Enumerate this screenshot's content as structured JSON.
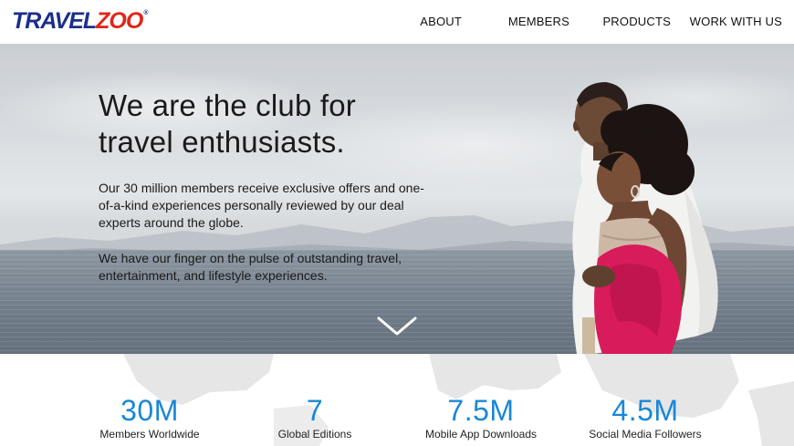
{
  "header": {
    "logo": {
      "text_main": "TRAVEL",
      "text_accent": "ZOO",
      "registered": "®"
    },
    "nav": [
      {
        "label": "ABOUT"
      },
      {
        "label": "MEMBERS"
      },
      {
        "label": "PRODUCTS"
      },
      {
        "label": "WORK WITH US"
      }
    ]
  },
  "hero": {
    "title_line1": "We are the club for",
    "title_line2": "travel enthusiasts.",
    "paragraph1": "Our 30 million members receive exclusive offers and one-of-a-kind experiences personally reviewed by our deal experts around the globe.",
    "paragraph2": "We have our finger on the pulse of outstanding travel, entertainment, and lifestyle experiences.",
    "scroll_icon": "chevron-down-icon"
  },
  "stats": [
    {
      "value": "30M",
      "label": "Members Worldwide"
    },
    {
      "value": "7",
      "label": "Global Editions"
    },
    {
      "value": "7.5M",
      "label": "Mobile App Downloads"
    },
    {
      "value": "4.5M",
      "label": "Social Media Followers"
    }
  ],
  "colors": {
    "logo_blue": "#1b2f8a",
    "logo_red": "#e0261b",
    "stat_blue": "#1a87d6"
  }
}
